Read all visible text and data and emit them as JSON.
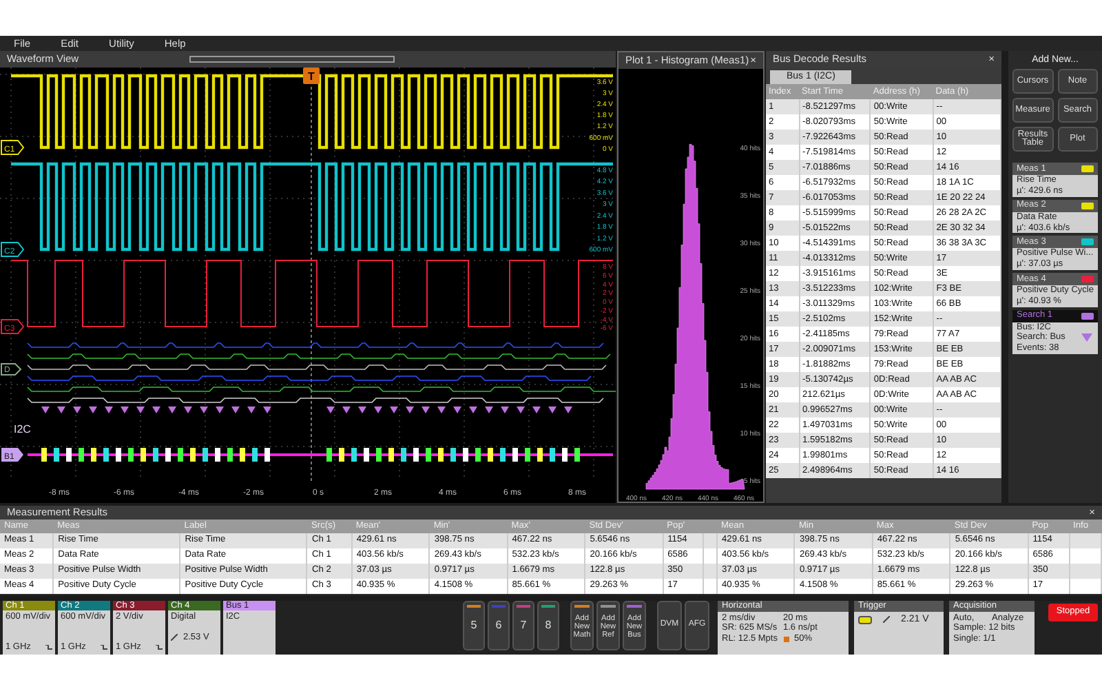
{
  "menu": [
    "File",
    "Edit",
    "Utility",
    "Help"
  ],
  "waveform_view": {
    "title": "Waveform View",
    "trigger_marker": "T",
    "bus_marker": "B1",
    "bus_label": "I2C",
    "digital_marker": "D",
    "channels": [
      {
        "marker": "C1",
        "color": "#e8e000",
        "scale": [
          "3.6 V",
          "3 V",
          "2.4 V",
          "1.8 V",
          "1.2 V",
          "600 mV",
          "0 V"
        ]
      },
      {
        "marker": "C2",
        "color": "#10c4cc",
        "scale": [
          "4.8 V",
          "4.2 V",
          "3.6 V",
          "3 V",
          "2.4 V",
          "1.8 V",
          "1.2 V",
          "600 mV"
        ]
      },
      {
        "marker": "C3",
        "color": "#e8203c",
        "scale": [
          "8 V",
          "6 V",
          "4 V",
          "2 V",
          "0 V",
          "-2 V",
          "-4 V",
          "-6 V"
        ]
      }
    ],
    "x_labels": [
      "-8 ms",
      "-6 ms",
      "-4 ms",
      "-2 ms",
      "0 s",
      "2 ms",
      "4 ms",
      "6 ms",
      "8 ms"
    ]
  },
  "histogram": {
    "title": "Plot 1 - Histogram (Meas1)",
    "close": "×",
    "y_labels": [
      "40 hits",
      "35 hits",
      "30 hits",
      "25 hits",
      "20 hits",
      "15 hits",
      "10 hits",
      "5 hits"
    ],
    "x_labels": [
      "400 ns",
      "420 ns",
      "440 ns",
      "460 ns"
    ]
  },
  "bus_decode": {
    "title": "Bus Decode Results",
    "close": "×",
    "tabs": [
      {
        "label": "Bus 1 (I2C)",
        "selected": true
      }
    ],
    "columns": [
      "Index",
      "Start Time",
      "Address (h)",
      "Data (h)"
    ],
    "rows": [
      [
        "1",
        "-8.521297ms",
        "00:Write",
        "--"
      ],
      [
        "2",
        "-8.020793ms",
        "50:Write",
        "00"
      ],
      [
        "3",
        "-7.922643ms",
        "50:Read",
        "10"
      ],
      [
        "4",
        "-7.519814ms",
        "50:Read",
        "12"
      ],
      [
        "5",
        "-7.01886ms",
        "50:Read",
        "14 16"
      ],
      [
        "6",
        "-6.517932ms",
        "50:Read",
        "18 1A 1C"
      ],
      [
        "7",
        "-6.017053ms",
        "50:Read",
        "1E 20 22 24"
      ],
      [
        "8",
        "-5.515999ms",
        "50:Read",
        "26 28 2A 2C"
      ],
      [
        "9",
        "-5.01522ms",
        "50:Read",
        "2E 30 32 34"
      ],
      [
        "10",
        "-4.514391ms",
        "50:Read",
        "36 38 3A 3C"
      ],
      [
        "11",
        "-4.013312ms",
        "50:Write",
        "17"
      ],
      [
        "12",
        "-3.915161ms",
        "50:Read",
        "3E"
      ],
      [
        "13",
        "-3.512233ms",
        "102:Write",
        "F3 BE"
      ],
      [
        "14",
        "-3.011329ms",
        "103:Write",
        "66 BB"
      ],
      [
        "15",
        "-2.5102ms",
        "152:Write",
        "--"
      ],
      [
        "16",
        "-2.41185ms",
        "79:Read",
        "77 A7"
      ],
      [
        "17",
        "-2.009071ms",
        "153:Write",
        "BE EB"
      ],
      [
        "18",
        "-1.81882ms",
        "79:Read",
        "BE EB"
      ],
      [
        "19",
        "-5.130742µs",
        "0D:Read",
        "AA AB AC"
      ],
      [
        "20",
        "212.621µs",
        "0D:Write",
        "AA AB AC"
      ],
      [
        "21",
        "0.996527ms",
        "00:Write",
        "--"
      ],
      [
        "22",
        "1.497031ms",
        "50:Write",
        "00"
      ],
      [
        "23",
        "1.595182ms",
        "50:Read",
        "10"
      ],
      [
        "24",
        "1.99801ms",
        "50:Read",
        "12"
      ],
      [
        "25",
        "2.498964ms",
        "50:Read",
        "14 16"
      ]
    ]
  },
  "side_panel": {
    "title": "Add New...",
    "buttons": [
      "Cursors",
      "Note",
      "Measure",
      "Search",
      "Results Table",
      "Plot"
    ],
    "badges": [
      {
        "kind": "meas",
        "title": "Meas 1",
        "color": "#e8e000",
        "lines": [
          "Rise Time",
          "µ': 429.6 ns"
        ]
      },
      {
        "kind": "meas",
        "title": "Meas 2",
        "color": "#e8e000",
        "lines": [
          "Data Rate",
          "µ': 403.6 kb/s"
        ]
      },
      {
        "kind": "meas",
        "title": "Meas 3",
        "color": "#10c4cc",
        "lines": [
          "Positive Pulse Wi...",
          "µ': 37.03 µs"
        ]
      },
      {
        "kind": "meas",
        "title": "Meas 4",
        "color": "#e8203c",
        "lines": [
          "Positive Duty Cycle",
          "µ': 40.93 %"
        ]
      },
      {
        "kind": "search",
        "title": "Search 1",
        "color": "#b070e0",
        "lines": [
          "Bus: I2C",
          "Search: Bus",
          "Events: 38"
        ]
      }
    ]
  },
  "measurement_results": {
    "title": "Measurement Results",
    "close": "×",
    "columns": [
      "Name",
      "Meas",
      "Label",
      "Src(s)",
      "Mean'",
      "Min'",
      "Max'",
      "Std Dev'",
      "Pop'",
      "",
      "Mean",
      "Min",
      "Max",
      "Std Dev",
      "Pop",
      "Info"
    ],
    "rows": [
      [
        "Meas 1",
        "Rise Time",
        "Rise Time",
        "Ch 1",
        "429.61 ns",
        "398.75 ns",
        "467.22 ns",
        "5.6546 ns",
        "1154",
        "",
        "429.61 ns",
        "398.75 ns",
        "467.22 ns",
        "5.6546 ns",
        "1154",
        ""
      ],
      [
        "Meas 2",
        "Data Rate",
        "Data Rate",
        "Ch 1",
        "403.56 kb/s",
        "269.43 kb/s",
        "532.23 kb/s",
        "20.166 kb/s",
        "6586",
        "",
        "403.56 kb/s",
        "269.43 kb/s",
        "532.23 kb/s",
        "20.166 kb/s",
        "6586",
        ""
      ],
      [
        "Meas 3",
        "Positive Pulse Width",
        "Positive Pulse Width",
        "Ch 2",
        "37.03 µs",
        "0.9717 µs",
        "1.6679 ms",
        "122.8 µs",
        "350",
        "",
        "37.03 µs",
        "0.9717 µs",
        "1.6679 ms",
        "122.8 µs",
        "350",
        ""
      ],
      [
        "Meas 4",
        "Positive Duty Cycle",
        "Positive Duty Cycle",
        "Ch 3",
        "40.935 %",
        "4.1508 %",
        "85.661 %",
        "29.263 %",
        "17",
        "",
        "40.935 %",
        "4.1508 %",
        "85.661 %",
        "29.263 %",
        "17",
        ""
      ]
    ]
  },
  "bottom_bar": {
    "channels": [
      {
        "kind": "analog",
        "title": "Ch 1",
        "color": "#8a8a10",
        "lines": [
          "600 mV/div",
          "1 GHz"
        ]
      },
      {
        "kind": "analog",
        "title": "Ch 2",
        "color": "#107a80",
        "lines": [
          "600 mV/div",
          "1 GHz"
        ]
      },
      {
        "kind": "analog",
        "title": "Ch 3",
        "color": "#8a1c2c",
        "lines": [
          "2 V/div",
          "1 GHz"
        ]
      },
      {
        "kind": "digital",
        "title": "Ch 4",
        "color": "#3a6a20",
        "lines": [
          "Digital",
          "2.53 V"
        ]
      },
      {
        "kind": "bus",
        "title": "Bus 1",
        "color": "#c890f0",
        "lines": [
          "I2C"
        ]
      }
    ],
    "number_buttons": [
      {
        "label": "5",
        "color": "#d08020"
      },
      {
        "label": "6",
        "color": "#4040c0"
      },
      {
        "label": "7",
        "color": "#c04080"
      },
      {
        "label": "8",
        "color": "#20a070"
      }
    ],
    "add_buttons": [
      {
        "label": "Add New Math",
        "color": "#d08020"
      },
      {
        "label": "Add New Ref",
        "color": "#909090"
      },
      {
        "label": "Add New Bus",
        "color": "#a060d0"
      }
    ],
    "tool_buttons": [
      "DVM",
      "AFG"
    ],
    "horizontal": {
      "title": "Horizontal",
      "cells": [
        "2 ms/div",
        "20 ms",
        "SR: 625 MS/s",
        "1.6 ns/pt",
        "RL: 12.5 Mpts",
        "50%"
      ]
    },
    "trigger": {
      "title": "Trigger",
      "level": "2.21 V"
    },
    "acquisition": {
      "title": "Acquisition",
      "cells": [
        "Auto,",
        "Analyze",
        "Sample: 12 bits",
        "Single: 1/1"
      ]
    },
    "run_state": "Stopped"
  }
}
